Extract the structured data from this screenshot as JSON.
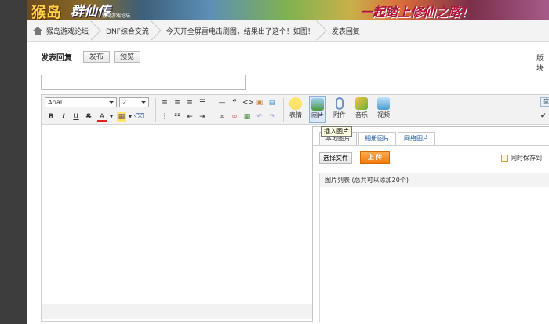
{
  "banner": {
    "left_text": "猴岛",
    "logo_text": "群仙传",
    "small_text": "猴岛游戏论坛",
    "slogan": "一起踏上修仙之路！"
  },
  "breadcrumb": [
    {
      "label": "猴岛游戏论坛"
    },
    {
      "label": "DNF综合交流"
    },
    {
      "label": "今天开全屏雷电击刷图，结果出了这个！如图！"
    },
    {
      "label": "发表回复"
    }
  ],
  "header": {
    "title": "发表回复",
    "publish_label": "发布",
    "preview_label": "预览",
    "right_text": "版块"
  },
  "subject": {
    "value": "",
    "placeholder": ""
  },
  "toolbar": {
    "font_family": "Arial",
    "font_size": "2",
    "buttons": [
      {
        "label": "表情",
        "icon": "smiley-icon"
      },
      {
        "label": "图片",
        "icon": "image-icon"
      },
      {
        "label": "附件",
        "icon": "attachment-icon"
      },
      {
        "label": "音乐",
        "icon": "music-icon"
      },
      {
        "label": "视频",
        "icon": "video-icon"
      }
    ],
    "edge_label": "简",
    "tooltip": "插入图片"
  },
  "image_panel": {
    "tabs": [
      {
        "label": "本地图片"
      },
      {
        "label": "相册图片"
      },
      {
        "label": "网络图片"
      }
    ],
    "select_file_label": "选择文件",
    "upload_label": "上 传",
    "also_save_label": "同时保存到",
    "list_header": "图片列表 (总共可以添加20个)"
  }
}
